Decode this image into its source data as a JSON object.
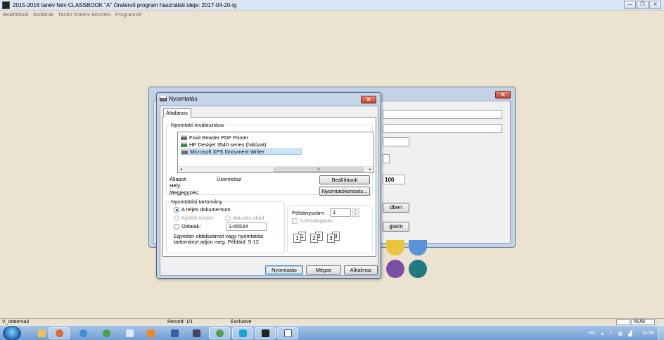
{
  "app": {
    "title": "2015-2016 tanév   Név  CLASSBOOK \"A\" Óratervő program használati ideje: 2017-04-20-ig",
    "menu": [
      "Beállítások",
      "Szótárak",
      "Tanári óraterv készítés",
      "Programról"
    ],
    "window_controls": [
      "—",
      "❐",
      "✕"
    ]
  },
  "bg_window": {
    "value_100": "100",
    "btn_partial_1": "dben",
    "btn_partial_2": "gsem",
    "close": "✕"
  },
  "print_dialog": {
    "title": "Nyomtatás",
    "close": "✕",
    "tab": "Általános",
    "printer_group_label": "Nyomtató kiválasztása",
    "printers": [
      {
        "name": "Foxit Reader PDF Printer",
        "selected": false
      },
      {
        "name": "HP Deskjet 3540 series (hálózat)",
        "selected": false
      },
      {
        "name": "Microsoft XPS Document Writer",
        "selected": true
      }
    ],
    "scroll_left": "◂",
    "scroll_right": "▸",
    "scroll_thumb": "III",
    "status_label": "Állapot:",
    "status_value": "Üzemkész",
    "location_label": "Hely:",
    "comment_label": "Megjegyzés:",
    "settings_button": "Beállítások",
    "find_printer_button": "Nyomtatókeresés...",
    "range_group_label": "Nyomtatási tartomány",
    "range_all": "A teljes dokumentum",
    "range_selection": "Kijelölt terület",
    "range_current": "Aktuális oldal",
    "range_pages": "Oldalak:",
    "pages_value": "1-65534",
    "range_hint": "Egyetlen oldalszámot vagy nyomtatási tartományt adjon meg. Például: 5-12.",
    "copies_label": "Példányszám:",
    "copies_value": "1",
    "collate_label": "Szétválogatás",
    "print_button": "Nyomtatás",
    "cancel_button": "Mégse",
    "apply_button": "Alkalmaz"
  },
  "status_bar": {
    "form": "V_oraterva3",
    "record": "Record: 1/1",
    "mode": "Exclusive",
    "num": "NUM"
  },
  "taskbar": {
    "lang": "HU",
    "time": "16:58"
  },
  "colors": {
    "dot_yellow": "#e8c53a",
    "dot_blue": "#5a93d8",
    "dot_purple": "#7b4ea8",
    "dot_teal": "#1f7a82"
  }
}
